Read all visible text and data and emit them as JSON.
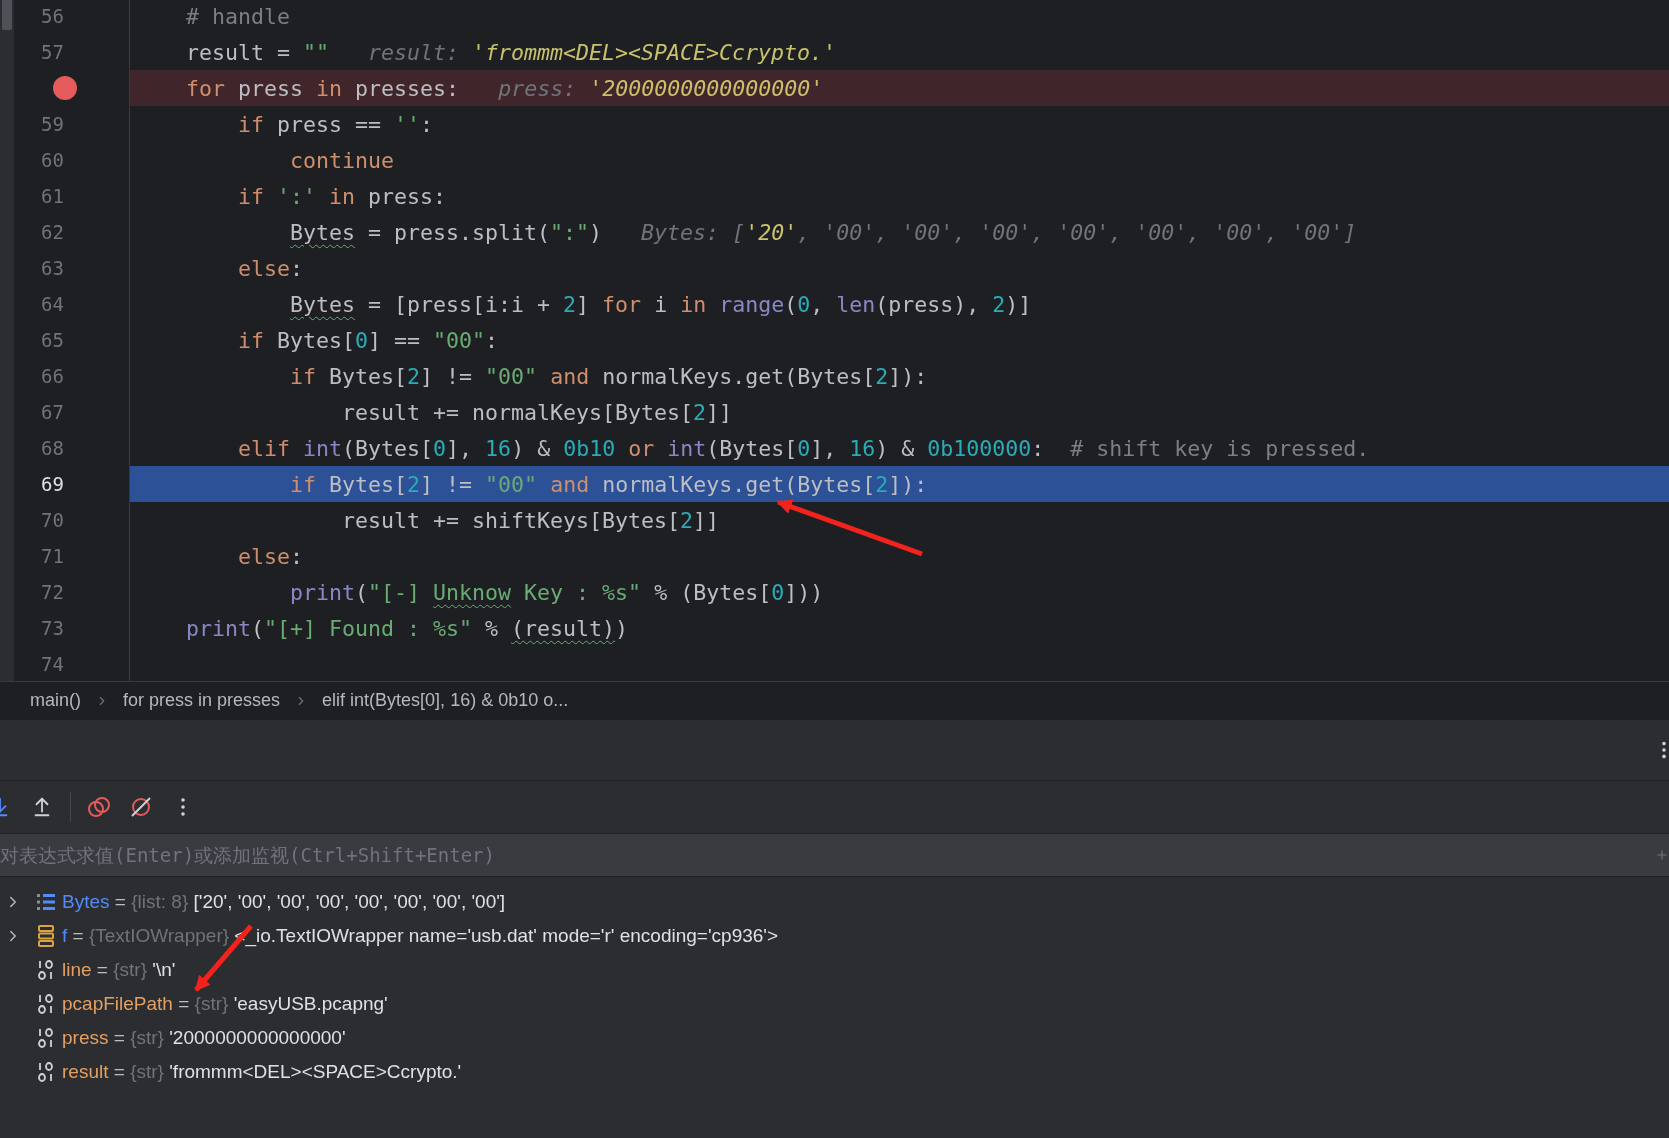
{
  "editor": {
    "lines": [
      {
        "number": "56",
        "breakpoint": false,
        "current": false,
        "tokens": [
          {
            "text": "    # handle",
            "kind": "comment"
          }
        ]
      },
      {
        "number": "57",
        "breakpoint": false,
        "current": false,
        "tokens": [
          {
            "text": "    result = ",
            "kind": "plain"
          },
          {
            "text": "\"\"",
            "kind": "string"
          },
          {
            "text": "   result: ",
            "kind": "hint-label"
          },
          {
            "text": "'frommm<DEL><SPACE>Ccrypto.'",
            "kind": "hint-value"
          }
        ]
      },
      {
        "breakpoint": true,
        "current": false,
        "tokens": [
          {
            "text": "    for",
            "kind": "keyword"
          },
          {
            "text": " press ",
            "kind": "plain"
          },
          {
            "text": "in",
            "kind": "keyword"
          },
          {
            "text": " presses:",
            "kind": "plain"
          },
          {
            "text": "   press: ",
            "kind": "hint-label"
          },
          {
            "text": "'2000000000000000'",
            "kind": "hint-value"
          }
        ]
      },
      {
        "number": "59",
        "breakpoint": false,
        "current": false,
        "tokens": [
          {
            "text": "        if",
            "kind": "keyword"
          },
          {
            "text": " press == ",
            "kind": "plain"
          },
          {
            "text": "''",
            "kind": "string"
          },
          {
            "text": ":",
            "kind": "plain"
          }
        ]
      },
      {
        "number": "60",
        "breakpoint": false,
        "current": false,
        "tokens": [
          {
            "text": "            continue",
            "kind": "keyword"
          }
        ]
      },
      {
        "number": "61",
        "breakpoint": false,
        "current": false,
        "tokens": [
          {
            "text": "        if ",
            "kind": "keyword"
          },
          {
            "text": "':'",
            "kind": "string"
          },
          {
            "text": " in",
            "kind": "keyword"
          },
          {
            "text": " press:",
            "kind": "plain"
          }
        ]
      },
      {
        "number": "62",
        "breakpoint": false,
        "current": false,
        "tokens": [
          {
            "text": "            Bytes",
            "kind": "plain",
            "squiggle": true
          },
          {
            "text": " = press.split(",
            "kind": "plain"
          },
          {
            "text": "\":\"",
            "kind": "string"
          },
          {
            "text": ")",
            "kind": "plain"
          },
          {
            "text": "   Bytes: [",
            "kind": "hint-label"
          },
          {
            "text": "'20'",
            "kind": "hint-value"
          },
          {
            "text": ", '00', '00', '00', '00', '00', '00', '00']",
            "kind": "hint-label"
          }
        ]
      },
      {
        "number": "63",
        "breakpoint": false,
        "current": false,
        "tokens": [
          {
            "text": "        else",
            "kind": "keyword"
          },
          {
            "text": ":",
            "kind": "plain"
          }
        ]
      },
      {
        "number": "64",
        "breakpoint": false,
        "current": false,
        "tokens": [
          {
            "text": "            Bytes",
            "kind": "plain",
            "squiggle": true
          },
          {
            "text": " = [press[i:i + ",
            "kind": "plain"
          },
          {
            "text": "2",
            "kind": "number"
          },
          {
            "text": "] ",
            "kind": "plain"
          },
          {
            "text": "for",
            "kind": "keyword"
          },
          {
            "text": " i ",
            "kind": "plain"
          },
          {
            "text": "in",
            "kind": "keyword"
          },
          {
            "text": " range",
            "kind": "builtin"
          },
          {
            "text": "(",
            "kind": "plain"
          },
          {
            "text": "0",
            "kind": "number"
          },
          {
            "text": ", ",
            "kind": "plain"
          },
          {
            "text": "len",
            "kind": "builtin"
          },
          {
            "text": "(press), ",
            "kind": "plain"
          },
          {
            "text": "2",
            "kind": "number"
          },
          {
            "text": ")]",
            "kind": "plain"
          }
        ]
      },
      {
        "number": "65",
        "breakpoint": false,
        "current": false,
        "tokens": [
          {
            "text": "        if",
            "kind": "keyword"
          },
          {
            "text": " Bytes[",
            "kind": "plain"
          },
          {
            "text": "0",
            "kind": "number"
          },
          {
            "text": "] == ",
            "kind": "plain"
          },
          {
            "text": "\"00\"",
            "kind": "string"
          },
          {
            "text": ":",
            "kind": "plain"
          }
        ]
      },
      {
        "number": "66",
        "breakpoint": false,
        "current": false,
        "tokens": [
          {
            "text": "            if",
            "kind": "keyword"
          },
          {
            "text": " Bytes[",
            "kind": "plain"
          },
          {
            "text": "2",
            "kind": "number"
          },
          {
            "text": "] != ",
            "kind": "plain"
          },
          {
            "text": "\"00\"",
            "kind": "string"
          },
          {
            "text": " and",
            "kind": "keyword"
          },
          {
            "text": " normalKeys.get(Bytes[",
            "kind": "plain"
          },
          {
            "text": "2",
            "kind": "number"
          },
          {
            "text": "]):",
            "kind": "plain"
          }
        ]
      },
      {
        "number": "67",
        "breakpoint": false,
        "current": false,
        "tokens": [
          {
            "text": "                result += normalKeys[Bytes[",
            "kind": "plain"
          },
          {
            "text": "2",
            "kind": "number"
          },
          {
            "text": "]]",
            "kind": "plain"
          }
        ]
      },
      {
        "number": "68",
        "breakpoint": false,
        "current": false,
        "tokens": [
          {
            "text": "        elif",
            "kind": "keyword"
          },
          {
            "text": " int",
            "kind": "builtin"
          },
          {
            "text": "(Bytes[",
            "kind": "plain"
          },
          {
            "text": "0",
            "kind": "number"
          },
          {
            "text": "], ",
            "kind": "plain"
          },
          {
            "text": "16",
            "kind": "number"
          },
          {
            "text": ") & ",
            "kind": "plain"
          },
          {
            "text": "0b10",
            "kind": "number"
          },
          {
            "text": " or",
            "kind": "keyword"
          },
          {
            "text": " int",
            "kind": "builtin"
          },
          {
            "text": "(Bytes[",
            "kind": "plain"
          },
          {
            "text": "0",
            "kind": "number"
          },
          {
            "text": "], ",
            "kind": "plain"
          },
          {
            "text": "16",
            "kind": "number"
          },
          {
            "text": ") & ",
            "kind": "plain"
          },
          {
            "text": "0b100000",
            "kind": "number"
          },
          {
            "text": ":  ",
            "kind": "plain"
          },
          {
            "text": "# shift key is pressed.",
            "kind": "comment"
          }
        ]
      },
      {
        "number": "69",
        "breakpoint": false,
        "current": true,
        "tokens": [
          {
            "text": "            if",
            "kind": "keyword"
          },
          {
            "text": " Bytes[",
            "kind": "plain"
          },
          {
            "text": "2",
            "kind": "number"
          },
          {
            "text": "] != ",
            "kind": "plain"
          },
          {
            "text": "\"00\"",
            "kind": "string"
          },
          {
            "text": " and",
            "kind": "keyword"
          },
          {
            "text": " normalKeys.get(Bytes[",
            "kind": "plain"
          },
          {
            "text": "2",
            "kind": "number"
          },
          {
            "text": "]):",
            "kind": "plain"
          }
        ]
      },
      {
        "number": "70",
        "breakpoint": false,
        "current": false,
        "tokens": [
          {
            "text": "                result += shiftKeys[Bytes[",
            "kind": "plain"
          },
          {
            "text": "2",
            "kind": "number"
          },
          {
            "text": "]]",
            "kind": "plain"
          }
        ]
      },
      {
        "number": "71",
        "breakpoint": false,
        "current": false,
        "tokens": [
          {
            "text": "        else",
            "kind": "keyword"
          },
          {
            "text": ":",
            "kind": "plain"
          }
        ]
      },
      {
        "number": "72",
        "breakpoint": false,
        "current": false,
        "tokens": [
          {
            "text": "            print",
            "kind": "builtin"
          },
          {
            "text": "(",
            "kind": "plain"
          },
          {
            "text": "\"[-] ",
            "kind": "string"
          },
          {
            "text": "Unknow",
            "kind": "string",
            "squiggle": true
          },
          {
            "text": " Key : %s\"",
            "kind": "string"
          },
          {
            "text": " % (Bytes[",
            "kind": "plain"
          },
          {
            "text": "0",
            "kind": "number"
          },
          {
            "text": "]))",
            "kind": "plain"
          }
        ]
      },
      {
        "number": "73",
        "breakpoint": false,
        "current": false,
        "tokens": [
          {
            "text": "    print",
            "kind": "builtin"
          },
          {
            "text": "(",
            "kind": "plain"
          },
          {
            "text": "\"[+] Found : %s\"",
            "kind": "string"
          },
          {
            "text": " % ",
            "kind": "plain"
          },
          {
            "text": "(result)",
            "kind": "plain",
            "squiggle": true
          },
          {
            "text": ")",
            "kind": "plain"
          }
        ]
      },
      {
        "number": "74",
        "breakpoint": false,
        "current": false
      }
    ]
  },
  "breadcrumbs": [
    "main()",
    "for press in presses",
    "elif int(Bytes[0], 16) & 0b10 o..."
  ],
  "evaluate": {
    "placeholder": "对表达式求值(Enter)或添加监视(Ctrl+Shift+Enter)"
  },
  "variables": [
    {
      "kind": "list",
      "expandable": true,
      "name": "Bytes",
      "separator": "=",
      "type": "{list: 8}",
      "value": "['20', '00', '00', '00', '00', '00', '00', '00']"
    },
    {
      "kind": "object",
      "expandable": true,
      "name": "f",
      "separator": "=",
      "type": "{TextIOWrapper}",
      "value": "<_io.TextIOWrapper name='usb.dat' mode='r' encoding='cp936'>"
    },
    {
      "kind": "str",
      "expandable": false,
      "name": "line",
      "separator": "=",
      "type": "{str}",
      "value": "'\\n'"
    },
    {
      "kind": "str",
      "expandable": false,
      "name": "pcapFilePath",
      "separator": "=",
      "type": "{str}",
      "value": "'easyUSB.pcapng'"
    },
    {
      "kind": "str",
      "expandable": false,
      "name": "press",
      "separator": "=",
      "type": "{str}",
      "value": "'2000000000000000'"
    },
    {
      "kind": "str",
      "expandable": false,
      "name": "result",
      "separator": "=",
      "type": "{str}",
      "value": "'frommm<DEL><SPACE>Ccrypto.'"
    }
  ],
  "annotations": [
    {
      "kind": "arrow"
    },
    {
      "kind": "arrow"
    }
  ]
}
